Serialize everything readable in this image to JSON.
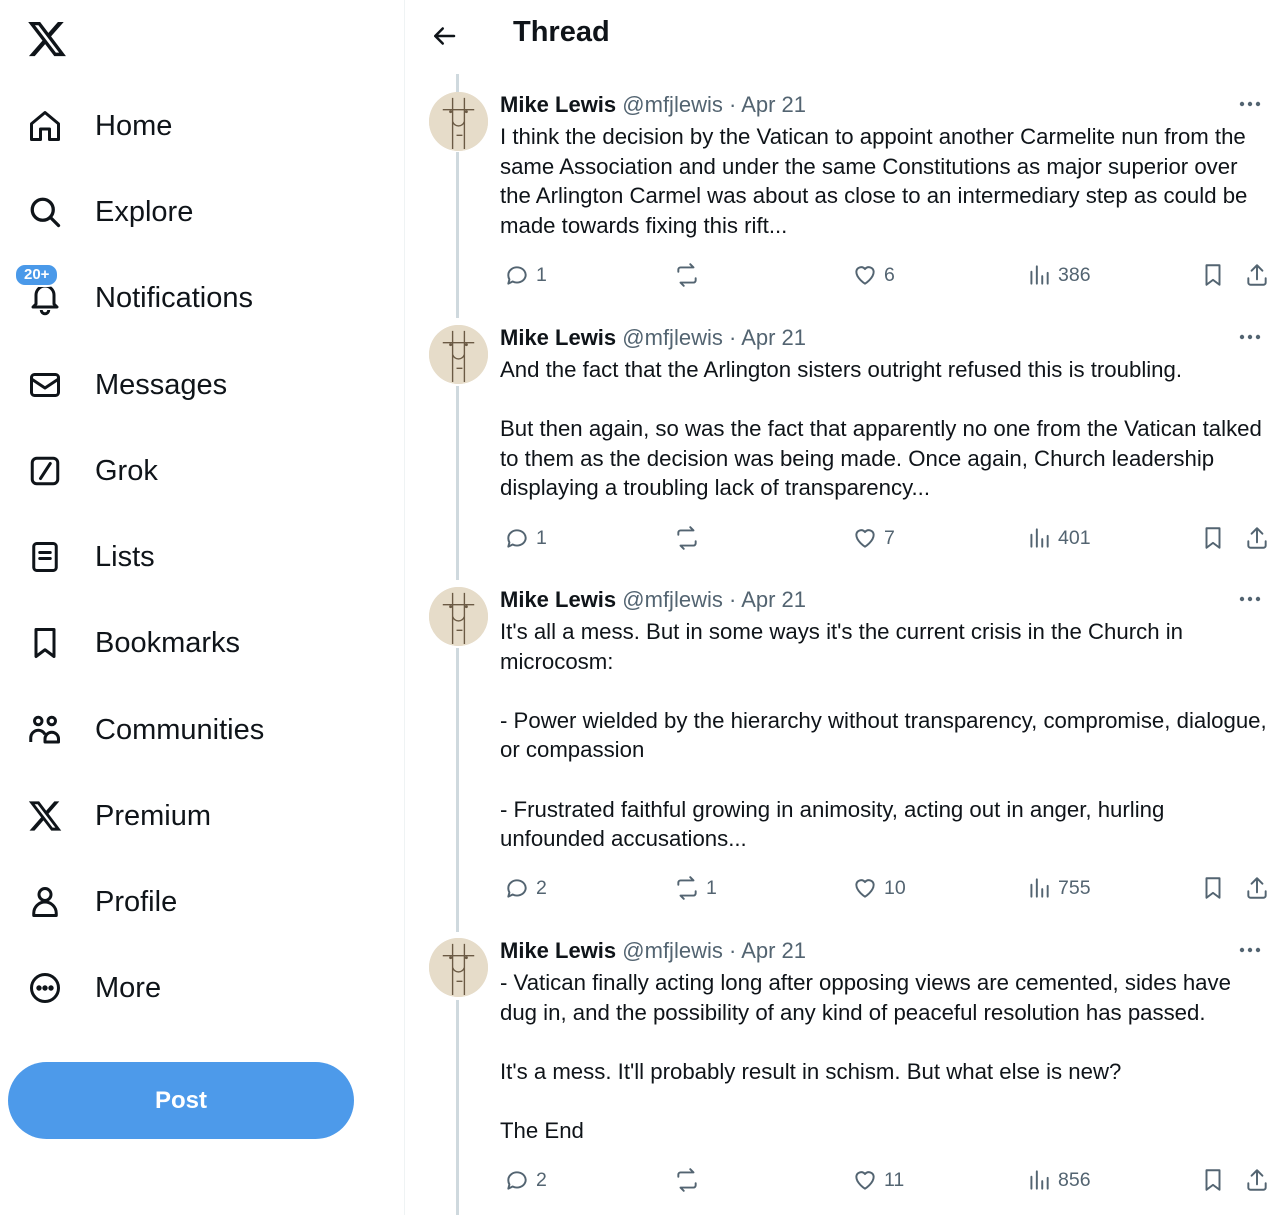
{
  "nav": {
    "items": [
      {
        "label": "Home",
        "icon": "home-icon"
      },
      {
        "label": "Explore",
        "icon": "search-icon"
      },
      {
        "label": "Notifications",
        "icon": "bell-icon",
        "badge": "20+"
      },
      {
        "label": "Messages",
        "icon": "mail-icon"
      },
      {
        "label": "Grok",
        "icon": "grok-icon"
      },
      {
        "label": "Lists",
        "icon": "list-icon"
      },
      {
        "label": "Bookmarks",
        "icon": "bookmark-icon"
      },
      {
        "label": "Communities",
        "icon": "people-icon"
      },
      {
        "label": "Premium",
        "icon": "x-logo-icon"
      },
      {
        "label": "Profile",
        "icon": "person-icon"
      },
      {
        "label": "More",
        "icon": "more-circle-icon"
      }
    ],
    "post_label": "Post"
  },
  "header": {
    "title": "Thread"
  },
  "tweets": [
    {
      "name": "Mike Lewis",
      "handle": "@mfjlewis",
      "sep": "·",
      "date": "Apr 21",
      "text": "I think the decision by the Vatican to appoint another Carmelite nun from the same Association and under the same Constitutions as major superior over the Arlington Carmel was about as close to an intermediary step as could be made towards fixing this rift...",
      "replies": "1",
      "reposts": "",
      "likes": "6",
      "views": "386"
    },
    {
      "name": "Mike Lewis",
      "handle": "@mfjlewis",
      "sep": "·",
      "date": "Apr 21",
      "text": "And the fact that the Arlington sisters outright refused this is troubling.\n\nBut then again, so was the fact that apparently no one from the Vatican talked to them as the decision was being made. Once again, Church leadership displaying a troubling lack of transparency...",
      "replies": "1",
      "reposts": "",
      "likes": "7",
      "views": "401"
    },
    {
      "name": "Mike Lewis",
      "handle": "@mfjlewis",
      "sep": "·",
      "date": "Apr 21",
      "text": "It's all a mess. But in some ways it's the current crisis in the Church in microcosm:\n\n- Power wielded by the hierarchy without transparency, compromise, dialogue, or compassion\n\n- Frustrated faithful growing in animosity, acting out in anger, hurling unfounded accusations...",
      "replies": "2",
      "reposts": "1",
      "likes": "10",
      "views": "755"
    },
    {
      "name": "Mike Lewis",
      "handle": "@mfjlewis",
      "sep": "·",
      "date": "Apr 21",
      "text": "- Vatican finally acting long after opposing views are cemented, sides have dug in, and the possibility of any kind of peaceful resolution has passed.\n\nIt's a mess. It'll probably result in schism. But what else is new?\n\nThe End",
      "replies": "2",
      "reposts": "",
      "likes": "11",
      "views": "856"
    }
  ],
  "colors": {
    "accent": "#4d9aea",
    "muted": "#536471",
    "text": "#0f1419",
    "border": "#eff3f4"
  }
}
